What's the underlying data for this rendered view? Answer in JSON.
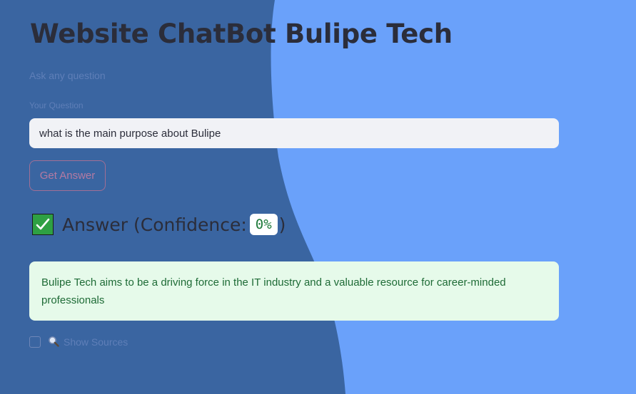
{
  "header": {
    "title": "Website ChatBot Bulipe Tech",
    "subtitle": "Ask any question"
  },
  "form": {
    "question_label": "Your Question",
    "question_value": "what is the main purpose about Bulipe",
    "submit_label": "Get Answer"
  },
  "answer": {
    "icon": "check-mark-icon",
    "heading_prefix": "Answer (Confidence: ",
    "confidence": "0%",
    "heading_suffix": ")",
    "text": "Bulipe Tech aims to be a driving force in the IT industry and a valuable resource for career-minded professionals"
  },
  "sources": {
    "icon": "magnifier-icon",
    "label": "Show Sources",
    "checked": false
  },
  "colors": {
    "background_light": "#6aa1fa",
    "background_dark": "#3a65a1",
    "title_text": "#2b2d3a",
    "success_bg": "#e6faea",
    "success_text": "#1e6b36",
    "button_border": "#a26f95"
  }
}
